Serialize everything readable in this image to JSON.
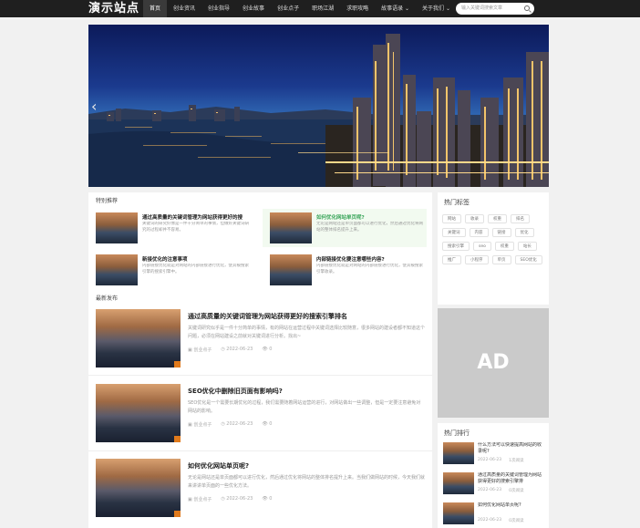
{
  "site": {
    "logo": "演示站点"
  },
  "nav": {
    "items": [
      "首页",
      "创业资讯",
      "创业指导",
      "创业故事",
      "创业点子",
      "职场江湖",
      "求职攻略",
      "故事语录 ⌄",
      "关于我们 ⌄"
    ],
    "active_index": 0
  },
  "search": {
    "placeholder": "输入关键词搜索文章"
  },
  "featured": {
    "title": "特别推荐",
    "items": [
      {
        "title": "通过高质量的关键词管理为网站获得更好的搜",
        "desc": "关键词的研究好像是一件十分简单的事情，但做好关键词研究的过程却并不容易。",
        "highlight": false
      },
      {
        "title": "如何优化网站单页呢?",
        "desc": "无论是网站还是单页面都可以进行优化，然后通过优化将网站的整体排名提升上来。",
        "highlight": true
      },
      {
        "title": "新接优化的注意事项",
        "desc": "内部链接优化就是对网站的内部链接进行优化，使其被搜索引擎的搜索引擎中。",
        "highlight": false
      },
      {
        "title": "内部链接优化要注意哪些内容?",
        "desc": "内部链接优化就是对网站的内部链接进行优化，使其被搜索引擎收录。",
        "highlight": false
      }
    ]
  },
  "latest": {
    "title": "最新发布",
    "posts": [
      {
        "title": "通过高质量的关键词管理为网站获得更好的搜索引擎排名",
        "desc": "关键词研究似乎是一件十分简单的事情，有的网站在运营过程中关键词选择比较随意，很多网站的建设者都不知道这个问题，必须在网站建设之前就对关键词进行分析。找出~",
        "category": "创业点子",
        "date": "2022-06-23",
        "views": "0"
      },
      {
        "title": "SEO优化中删除旧页面有影响吗?",
        "desc": "SEO优化是一个需要长期优化的过程，我们需要随着网站运营的进行，对网站做出一些调整，但是一定要注意避免对网站的影响。",
        "category": "创业点子",
        "date": "2022-06-23",
        "views": "0"
      },
      {
        "title": "如何优化网站单页呢?",
        "desc": "无论是网站还是单页面都可以进行优化，然后通过优化将网站的整体排名提升上来。当我们做网站的时候，今天我们就来讲讲单页面的一些优化方法。",
        "category": "创业点子",
        "date": "2022-06-23",
        "views": "0"
      }
    ]
  },
  "hot_tags": {
    "title": "热门标签",
    "tags": [
      "网站",
      "收录",
      "权重",
      "排名",
      "关键词",
      "内容",
      "链接",
      "优化",
      "搜索引擎",
      "seo",
      "权重",
      "站长",
      "推广",
      "小程序",
      "单页",
      "SEO优化"
    ]
  },
  "ad": {
    "text": "AD"
  },
  "hot_rank": {
    "title": "热门排行",
    "items": [
      {
        "title": "什么方法可以快速提高网站的收录呢?",
        "date": "2022-06-23",
        "views": "1次阅读"
      },
      {
        "title": "通过高质量的关键词管理为网站获得更好的搜索引擎排",
        "date": "2022-06-23",
        "views": "0次阅读"
      },
      {
        "title": "如何优化网站单页呢?",
        "date": "2022-06-23",
        "views": "0次阅读"
      }
    ]
  }
}
